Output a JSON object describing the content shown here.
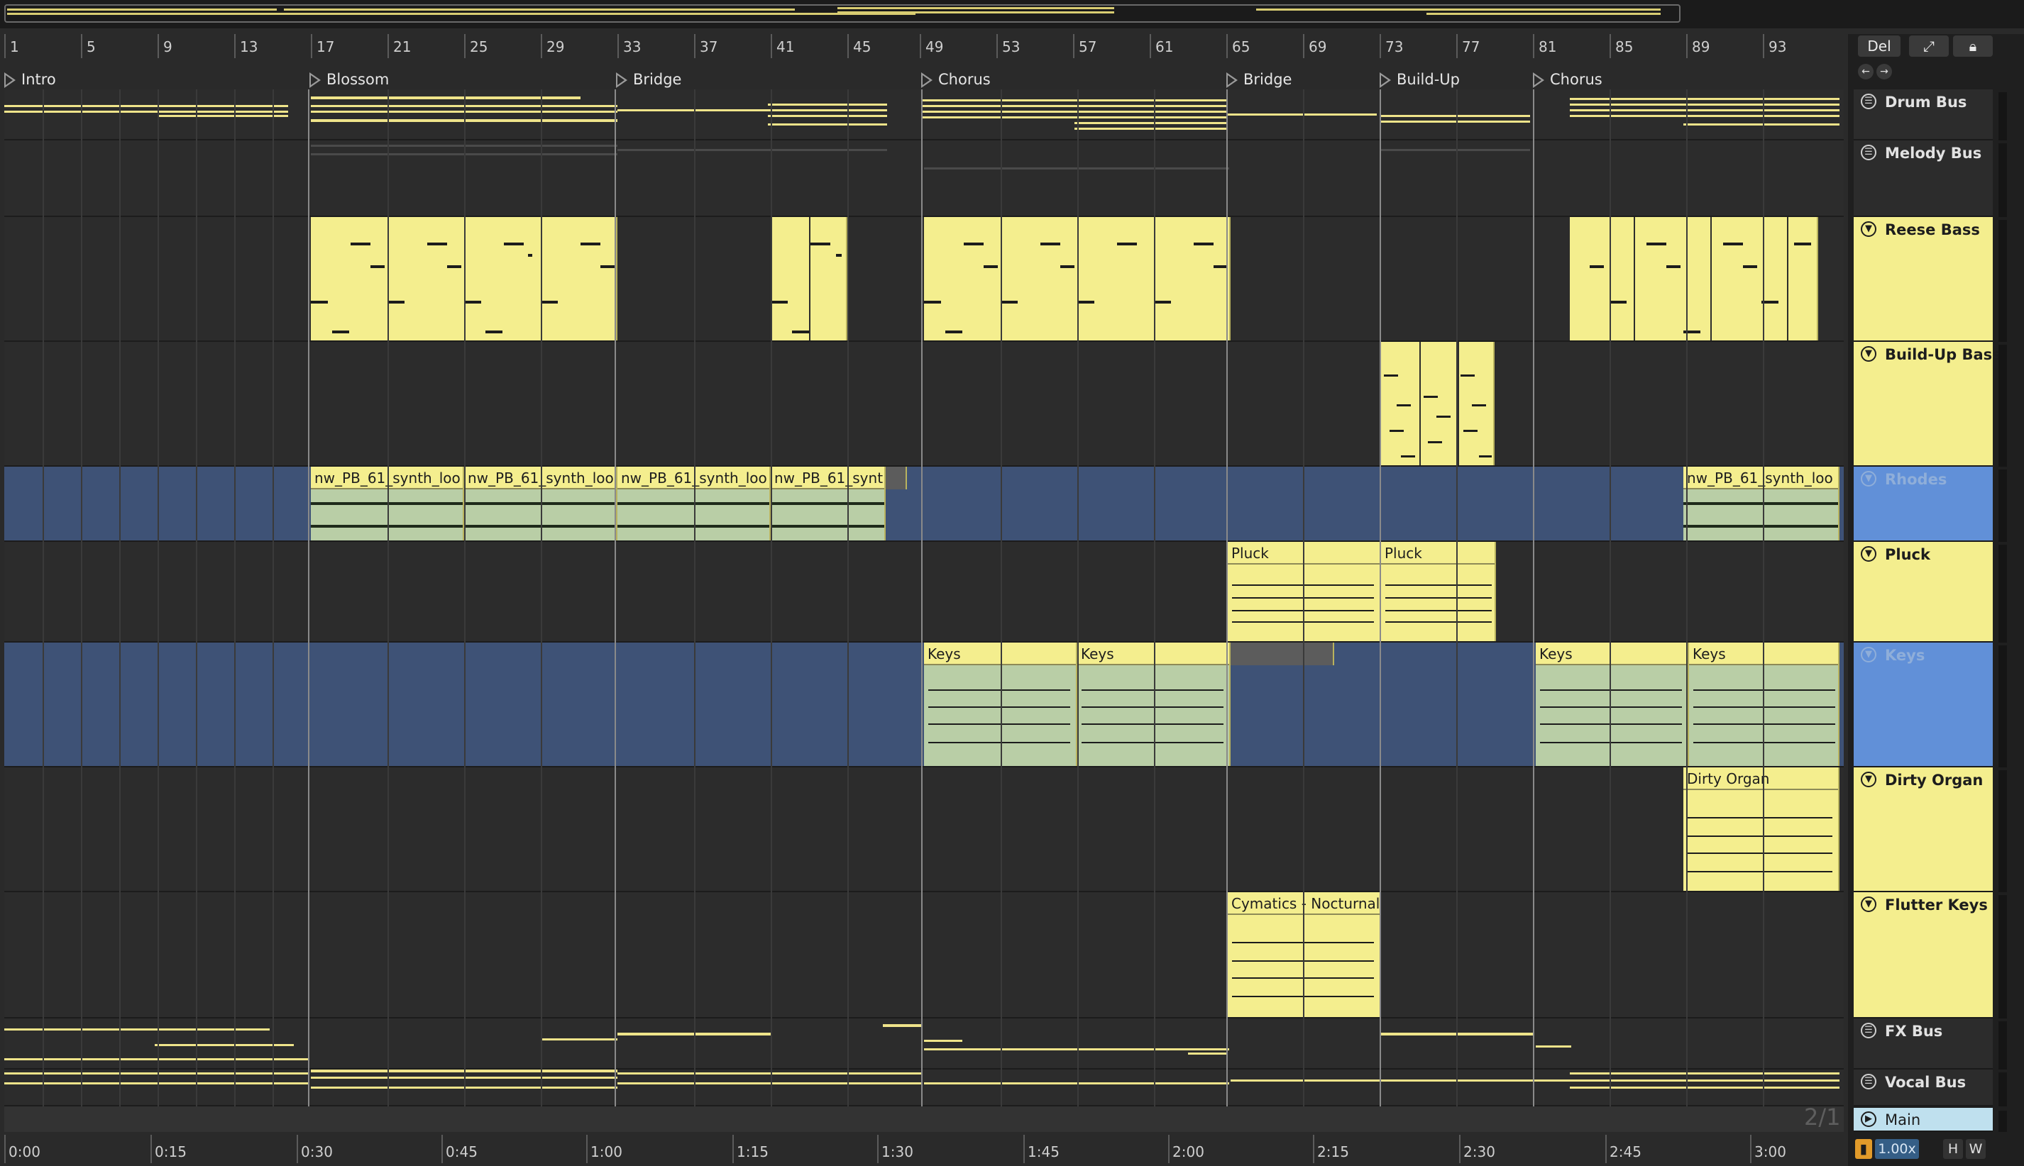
{
  "ruler": {
    "bars": [
      "1",
      "5",
      "9",
      "13",
      "17",
      "21",
      "25",
      "29",
      "33",
      "37",
      "41",
      "45",
      "49",
      "53",
      "57",
      "61",
      "65",
      "69",
      "73",
      "77",
      "81",
      "85",
      "89",
      "93"
    ]
  },
  "locators": [
    "Intro",
    "Blossom",
    "Bridge",
    "Chorus",
    "Bridge",
    "Build-Up",
    "Chorus"
  ],
  "toolbar": {
    "del_label": "Del",
    "expand_icon": "expand-icon",
    "lock_icon": "lock-icon",
    "back_icon": "arrow-left-icon",
    "forward_icon": "arrow-right-icon"
  },
  "tracks": [
    {
      "name": "Drum Bus",
      "icon": "group-icon",
      "color": "dark"
    },
    {
      "name": "Melody Bus",
      "icon": "group-icon",
      "color": "dark"
    },
    {
      "name": "Reese Bass",
      "icon": "midi-track-icon",
      "color": "yellow"
    },
    {
      "name": "Build-Up Bass",
      "icon": "midi-track-icon",
      "color": "yellow"
    },
    {
      "name": "Rhodes",
      "icon": "midi-track-icon",
      "color": "blue"
    },
    {
      "name": "Pluck",
      "icon": "midi-track-icon",
      "color": "yellow"
    },
    {
      "name": "Keys",
      "icon": "midi-track-icon",
      "color": "blue"
    },
    {
      "name": "Dirty Organ",
      "icon": "midi-track-icon",
      "color": "yellow"
    },
    {
      "name": "Flutter Keys",
      "icon": "midi-track-icon",
      "color": "yellow"
    },
    {
      "name": "FX Bus",
      "icon": "group-icon",
      "color": "dark"
    },
    {
      "name": "Vocal Bus",
      "icon": "group-icon",
      "color": "dark"
    },
    {
      "name": "Main",
      "icon": "play-icon",
      "color": "main"
    }
  ],
  "clips": {
    "rhodes": [
      "nw_PB_61_synth_loo",
      "nw_PB_61_synth_loo",
      "nw_PB_61_synth_loo",
      "nw_PB_61_synt",
      "nw_PB_61_synth_loo"
    ],
    "pluck": [
      "Pluck",
      "Pluck"
    ],
    "keys": [
      "Keys",
      "Keys",
      "Keys",
      "Keys"
    ],
    "dirty_organ": [
      "Dirty Organ"
    ],
    "flutter_keys": [
      "Cymatics - Nocturnal"
    ]
  },
  "time_ruler": [
    "0:00",
    "0:15",
    "0:30",
    "0:45",
    "1:00",
    "1:15",
    "1:30",
    "1:45",
    "2:00",
    "2:15",
    "2:30",
    "2:45",
    "3:00"
  ],
  "signature": "2/1",
  "bottom": {
    "zoom": "1.00x",
    "h_label": "H",
    "w_label": "W"
  },
  "colors": {
    "clip_yellow": "#f4ee8e",
    "clip_green": "#b9cea6",
    "selected_lane": "#3e5276",
    "track_blue": "#6190d8",
    "main_track": "#bfe0ee"
  }
}
